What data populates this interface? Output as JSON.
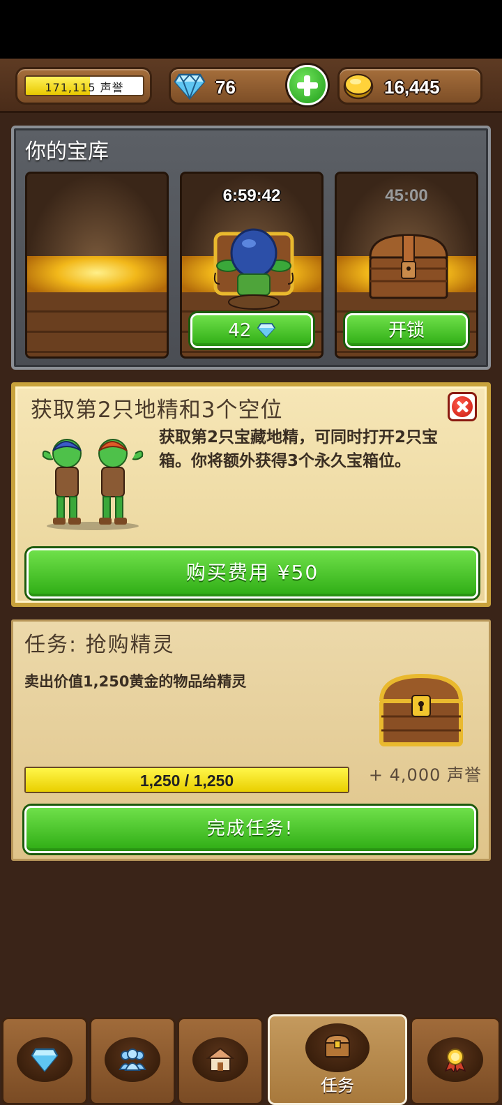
{
  "header": {
    "reputation": "171,115 声誉",
    "reputation_progress": 0.55,
    "gems": "76",
    "gold": "16,445"
  },
  "vault": {
    "title": "你的宝库",
    "slots": [
      {
        "state": "empty"
      },
      {
        "timer": "6:59:42",
        "button_label": "42"
      },
      {
        "timer": "45:00",
        "button_label": "开锁"
      }
    ]
  },
  "offer": {
    "title": "获取第2只地精和3个空位",
    "description": "获取第2只宝藏地精，可同时打开2只宝箱。你将额外获得3个永久宝箱位。",
    "buy_label": "购买费用 ¥50"
  },
  "quest": {
    "title": "任务: 抢购精灵",
    "description": "卖出价值1,250黄金的物品给精灵",
    "progress_text": "1,250 / 1,250",
    "progress": 1.0,
    "reward": "+ 4,000 声誉",
    "complete_label": "完成任务!"
  },
  "nav": {
    "items": [
      {
        "icon": "gem-icon"
      },
      {
        "icon": "people-icon"
      },
      {
        "icon": "house-icon"
      },
      {
        "icon": "chest-icon",
        "label": "任务",
        "active": true
      },
      {
        "icon": "medal-icon"
      }
    ]
  },
  "colors": {
    "accent_green": "#2eac14",
    "gold_fill": "#e9cf00",
    "wood": "#7a4b24"
  }
}
